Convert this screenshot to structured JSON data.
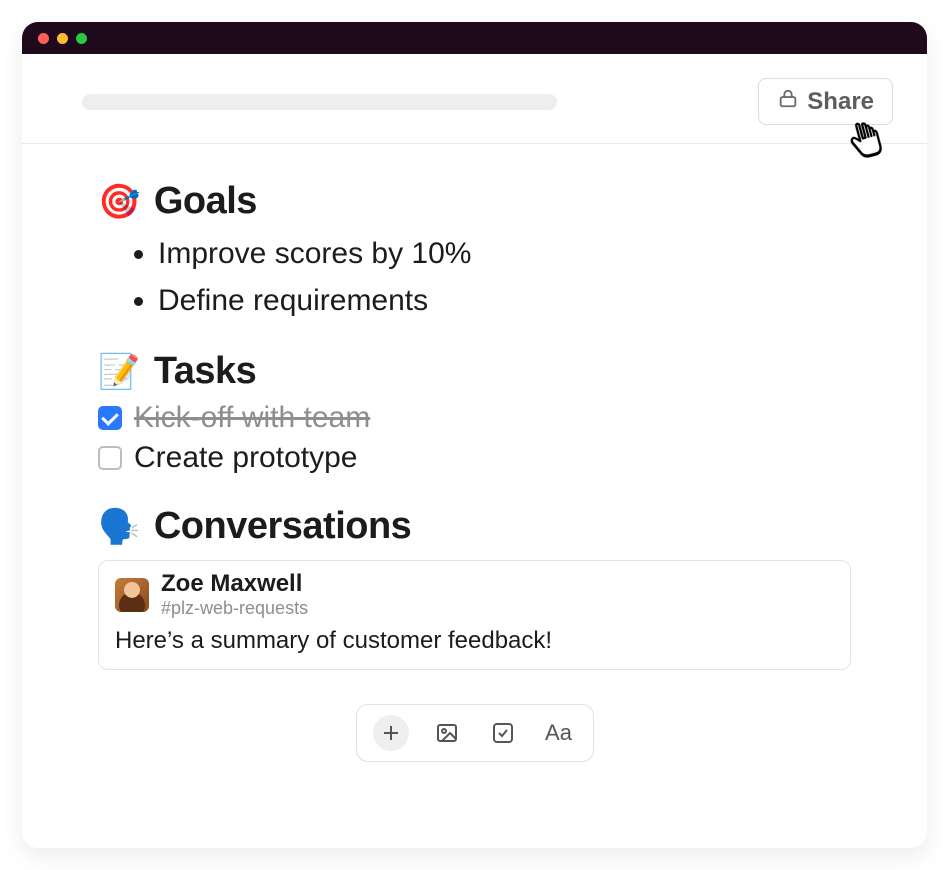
{
  "header": {
    "share_label": "Share"
  },
  "sections": {
    "goals": {
      "emoji": "🎯",
      "title": "Goals",
      "items": [
        "Improve scores by 10%",
        "Define requirements"
      ]
    },
    "tasks": {
      "emoji": "📝",
      "title": "Tasks",
      "items": [
        {
          "label": "Kick-off with team",
          "done": true
        },
        {
          "label": "Create prototype",
          "done": false
        }
      ]
    },
    "conversations": {
      "emoji": "🗣️",
      "title": "Conversations",
      "card": {
        "author": "Zoe Maxwell",
        "channel": "#plz-web-requests",
        "body": "Here’s a summary of customer feedback!"
      }
    }
  },
  "toolbar": {
    "text_format_label": "Aa"
  }
}
